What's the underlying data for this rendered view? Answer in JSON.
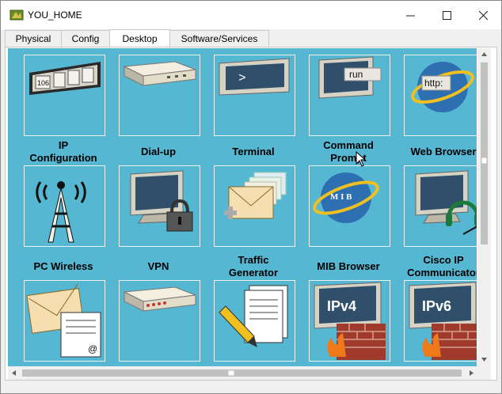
{
  "window": {
    "title": "YOU_HOME",
    "minimize": "—",
    "maximize": "☐",
    "close": "✕"
  },
  "tabs": [
    {
      "label": "Physical"
    },
    {
      "label": "Config"
    },
    {
      "label": "Desktop",
      "active": true
    },
    {
      "label": "Software/Services"
    }
  ],
  "apps": {
    "ip_config": {
      "label_line1": "IP",
      "label_line2": "Configuration",
      "icon_text": "106"
    },
    "dialup": {
      "label": "Dial-up"
    },
    "terminal": {
      "label": "Terminal",
      "icon_text": ">"
    },
    "cmd": {
      "label_line1": "Command",
      "label_line2": "Prompt",
      "icon_text": "run"
    },
    "web": {
      "label": "Web Browser",
      "icon_text": "http:"
    },
    "pc_wireless": {
      "label": "PC Wireless"
    },
    "vpn": {
      "label": "VPN"
    },
    "traffic": {
      "label_line1": "Traffic",
      "label_line2": "Generator"
    },
    "mib": {
      "label": "MIB Browser",
      "icon_text": "M I B"
    },
    "cisco_ip": {
      "label_line1": "Cisco IP",
      "label_line2": "Communicator"
    },
    "email": {
      "icon_text": "@"
    },
    "pppoe": {},
    "text_editor": {},
    "fw_ipv4": {
      "icon_text": "IPv4"
    },
    "fw_ipv6": {
      "icon_text": "IPv6"
    }
  },
  "colors": {
    "desktop_bg": "#56b7d2",
    "tile_border": "#e8f3f7",
    "firewall_brick": "#a03a2c"
  }
}
